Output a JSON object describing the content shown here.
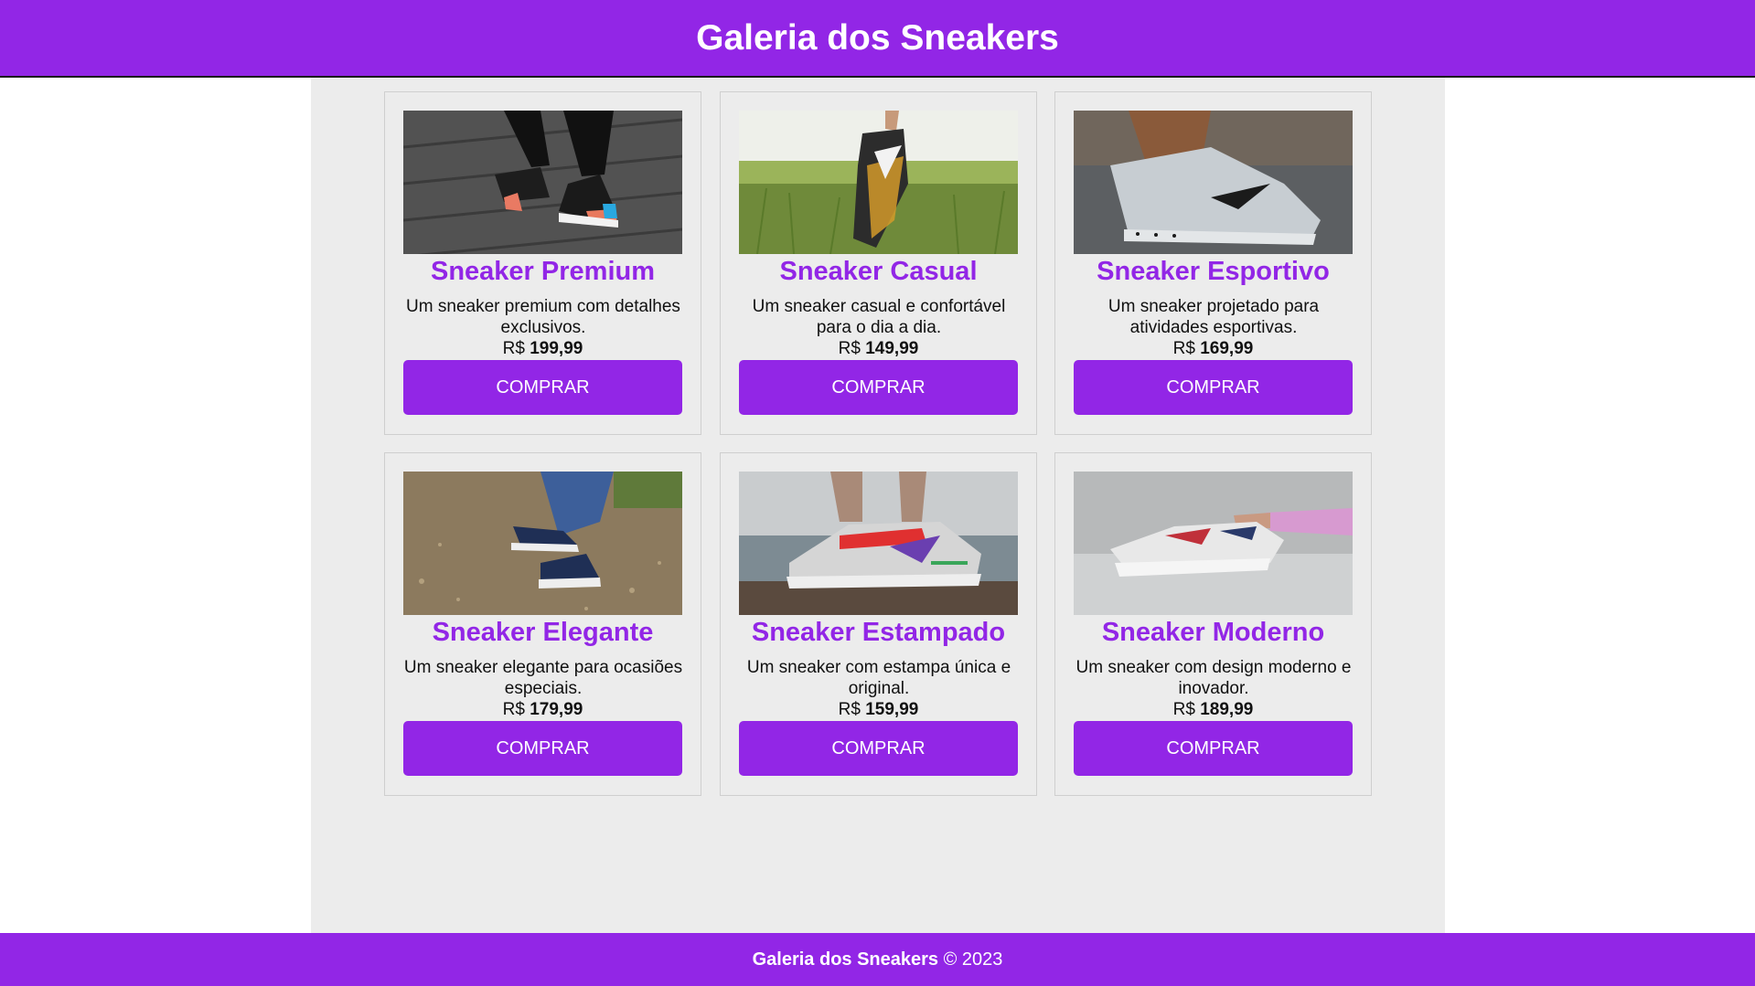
{
  "header": {
    "title": "Galeria dos Sneakers"
  },
  "colors": {
    "brand": "#9226e6",
    "content_bg": "#ececec",
    "text": "#111111"
  },
  "products": [
    {
      "name": "Sneaker Premium",
      "description": "Um sneaker premium com detalhes exclusivos.",
      "currency": "R$",
      "price": "199,99",
      "button": "COMPRAR",
      "image": "sneaker-premium-photo"
    },
    {
      "name": "Sneaker Casual",
      "description": "Um sneaker casual e confortável para o dia a dia.",
      "currency": "R$",
      "price": "149,99",
      "button": "COMPRAR",
      "image": "sneaker-casual-photo"
    },
    {
      "name": "Sneaker Esportivo",
      "description": "Um sneaker projetado para atividades esportivas.",
      "currency": "R$",
      "price": "169,99",
      "button": "COMPRAR",
      "image": "sneaker-esportivo-photo"
    },
    {
      "name": "Sneaker Elegante",
      "description": "Um sneaker elegante para ocasiões especiais.",
      "currency": "R$",
      "price": "179,99",
      "button": "COMPRAR",
      "image": "sneaker-elegante-photo"
    },
    {
      "name": "Sneaker Estampado",
      "description": "Um sneaker com estampa única e original.",
      "currency": "R$",
      "price": "159,99",
      "button": "COMPRAR",
      "image": "sneaker-estampado-photo"
    },
    {
      "name": "Sneaker Moderno",
      "description": "Um sneaker com design moderno e inovador.",
      "currency": "R$",
      "price": "189,99",
      "button": "COMPRAR",
      "image": "sneaker-moderno-photo"
    }
  ],
  "footer": {
    "brand": "Galeria dos Sneakers",
    "copyright": "© 2023"
  }
}
